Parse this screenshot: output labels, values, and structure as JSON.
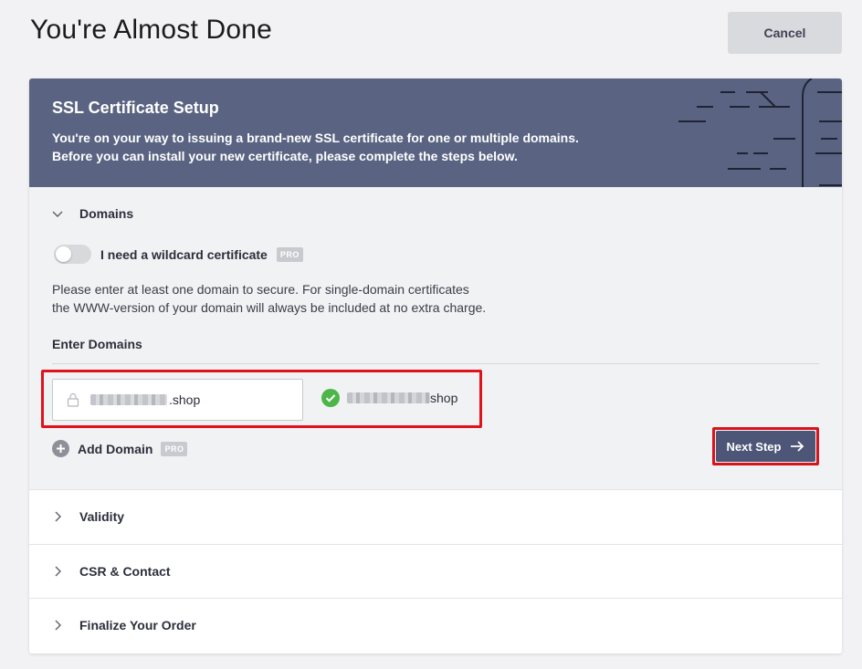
{
  "page": {
    "title": "You're Almost Done",
    "cancel_label": "Cancel"
  },
  "banner": {
    "title": "SSL Certificate Setup",
    "text_line1": "You're on your way to issuing a brand-new SSL certificate for one or multiple domains.",
    "text_line2": "Before you can install your new certificate, please complete the steps below."
  },
  "domains_section": {
    "title": "Domains",
    "wildcard_label": "I need a wildcard certificate",
    "wildcard_enabled": false,
    "pro_badge": "PRO",
    "description_line1": "Please enter at least one domain to secure. For single-domain certificates",
    "description_line2": "the WWW-version of your domain will always be included at no extra charge.",
    "enter_label": "Enter Domains",
    "domain_input_value": ".shop",
    "validated_domain_suffix": "shop",
    "add_domain_label": "Add Domain",
    "next_step_label": "Next Step"
  },
  "collapsed_sections": [
    {
      "title": "Validity"
    },
    {
      "title": "CSR & Contact"
    },
    {
      "title": "Finalize Your Order"
    }
  ],
  "colors": {
    "banner_bg": "#5a6482",
    "primary_button": "#4e5677",
    "success": "#4cb648",
    "highlight": "#e0121c"
  },
  "icons": [
    "chevron-down-icon",
    "chevron-right-icon",
    "lock-icon",
    "check-circle-icon",
    "plus-circle-icon",
    "arrow-right-icon"
  ]
}
